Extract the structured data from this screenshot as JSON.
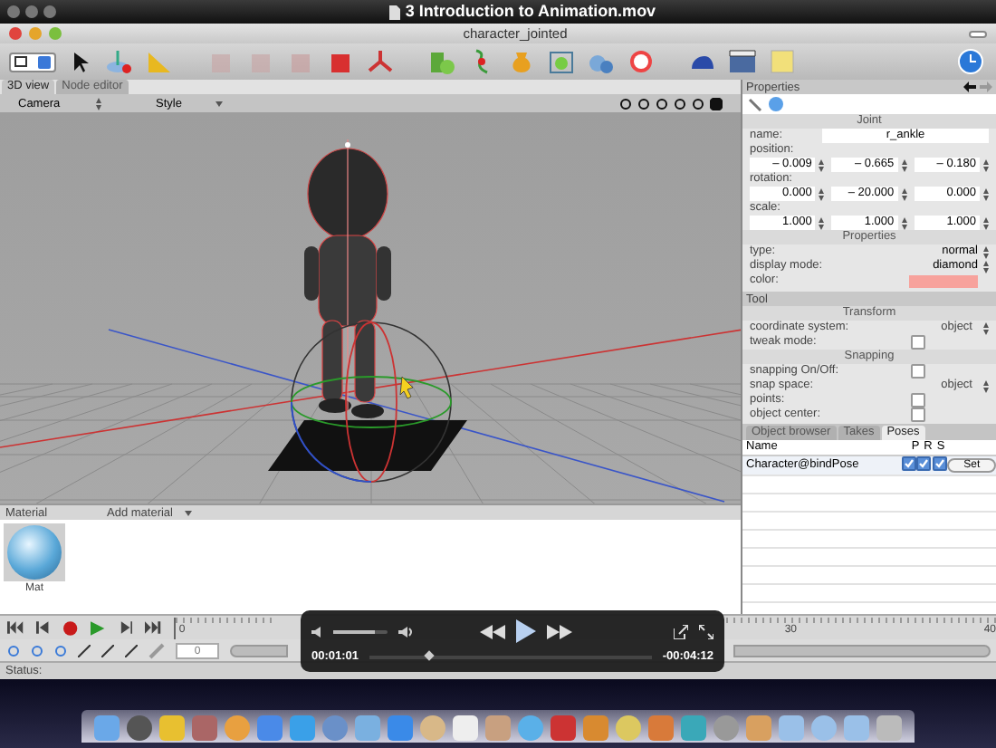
{
  "player": {
    "title": "3 Introduction to Animation.mov",
    "elapsed": "00:01:01",
    "remaining": "-00:04:12",
    "volume": {
      "level": 0.75
    },
    "scrubber": {
      "level": 0.2
    }
  },
  "window": {
    "title": "character_jointed"
  },
  "view_tabs": [
    {
      "label": "3D view",
      "selected": true
    },
    {
      "label": "Node editor",
      "selected": false
    }
  ],
  "view_bar": {
    "camera": "Camera",
    "style": "Style"
  },
  "material": {
    "header": "Material",
    "add": "Add material",
    "items": [
      {
        "name": "Mat"
      }
    ]
  },
  "timeline": {
    "labels": [
      "0",
      "30",
      "40"
    ],
    "frame": "0"
  },
  "status": "Status:",
  "properties": {
    "title": "Properties",
    "section": "Joint",
    "name_label": "name:",
    "name": "r_ankle",
    "position_label": "position:",
    "position": [
      "– 0.009",
      "– 0.665",
      "– 0.180"
    ],
    "rotation_label": "rotation:",
    "rotation": [
      "0.000",
      "– 20.000",
      "0.000"
    ],
    "scale_label": "scale:",
    "scale": [
      "1.000",
      "1.000",
      "1.000"
    ],
    "section2": "Properties",
    "type_label": "type:",
    "type": "normal",
    "mode_label": "display mode:",
    "mode": "diamond",
    "color_label": "color:",
    "color": "#f7a29c"
  },
  "tool": {
    "title": "Tool",
    "sections": [
      {
        "title": "Transform",
        "rows": [
          {
            "kind": "select",
            "label": "coordinate system:",
            "value": "object"
          },
          {
            "kind": "check",
            "label": "tweak mode:",
            "checked": false
          }
        ]
      },
      {
        "title": "Snapping",
        "rows": [
          {
            "kind": "check",
            "label": "snapping On/Off:",
            "checked": false
          },
          {
            "kind": "select",
            "label": "snap space:",
            "value": "object"
          },
          {
            "kind": "check",
            "label": "points:",
            "checked": false
          },
          {
            "kind": "check",
            "label": "object center:",
            "checked": false
          }
        ]
      }
    ]
  },
  "bottom_tabs": [
    {
      "label": "Object browser",
      "selected": false
    },
    {
      "label": "Takes",
      "selected": false
    },
    {
      "label": "Poses",
      "selected": true
    }
  ],
  "poses": {
    "columns": [
      "Name",
      "P",
      "R",
      "S"
    ],
    "rows": [
      {
        "name": "Character@bindPose",
        "p": true,
        "r": true,
        "s": true,
        "button": "Set"
      }
    ]
  }
}
